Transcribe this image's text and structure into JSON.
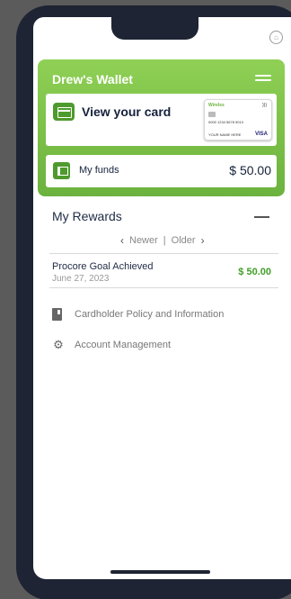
{
  "wallet": {
    "title": "Drew's Wallet",
    "card_label": "View your card",
    "mini_card": {
      "brand": "Wirelss",
      "number": "0000 1234 5678 9010",
      "name": "YOUR NAME HERE",
      "network": "VISA"
    },
    "funds_label": "My funds",
    "funds_amount": "$ 50.00"
  },
  "rewards": {
    "title": "My Rewards",
    "pager": {
      "newer": "Newer",
      "separator": "|",
      "older": "Older"
    },
    "items": [
      {
        "name": "Procore Goal Achieved",
        "date": "June 27, 2023",
        "amount": "$ 50.00"
      }
    ]
  },
  "links": [
    {
      "label": "Cardholder Policy and Information",
      "icon": "document-icon"
    },
    {
      "label": "Account Management",
      "icon": "gear-icon"
    }
  ],
  "colors": {
    "brand_green": "#6cb23e",
    "amount_green": "#3f9e27",
    "frame": "#1e2433"
  }
}
